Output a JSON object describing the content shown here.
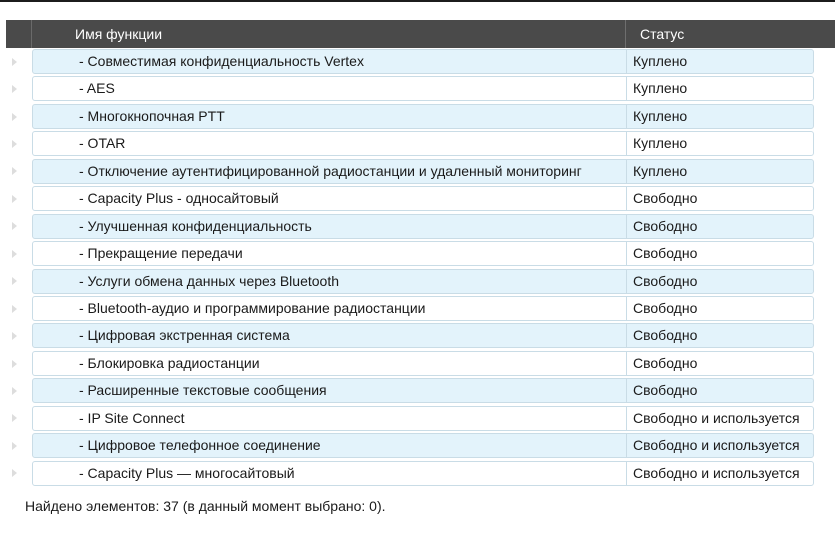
{
  "table": {
    "columns": {
      "name": "Имя функции",
      "status": "Статус"
    },
    "rows": [
      {
        "name": "- Совместимая конфиденциальность Vertex",
        "status": "Куплено"
      },
      {
        "name": "- AES",
        "status": "Куплено"
      },
      {
        "name": "- Многокнопочная PTT",
        "status": "Куплено"
      },
      {
        "name": "- OTAR",
        "status": "Куплено"
      },
      {
        "name": "- Отключение аутентифицированной радиостанции и удаленный мониторинг",
        "status": "Куплено"
      },
      {
        "name": "- Capacity Plus - односайтовый",
        "status": "Свободно"
      },
      {
        "name": "- Улучшенная конфиденциальность",
        "status": "Свободно"
      },
      {
        "name": "- Прекращение передачи",
        "status": "Свободно"
      },
      {
        "name": "- Услуги обмена данных через Bluetooth",
        "status": "Свободно"
      },
      {
        "name": "- Bluetooth-аудио и программирование радиостанции",
        "status": "Свободно"
      },
      {
        "name": "- Цифровая экстренная система",
        "status": "Свободно"
      },
      {
        "name": "- Блокировка радиостанции",
        "status": "Свободно"
      },
      {
        "name": "- Расширенные текстовые сообщения",
        "status": "Свободно"
      },
      {
        "name": "- IP Site Connect",
        "status": "Свободно и используется"
      },
      {
        "name": "- Цифровое телефонное соединение",
        "status": "Свободно и используется"
      },
      {
        "name": "- Capacity Plus — многосайтовый",
        "status": "Свободно и используется"
      }
    ]
  },
  "footer": {
    "status_text": "Найдено элементов: 37 (в данный момент выбрано: 0)."
  }
}
